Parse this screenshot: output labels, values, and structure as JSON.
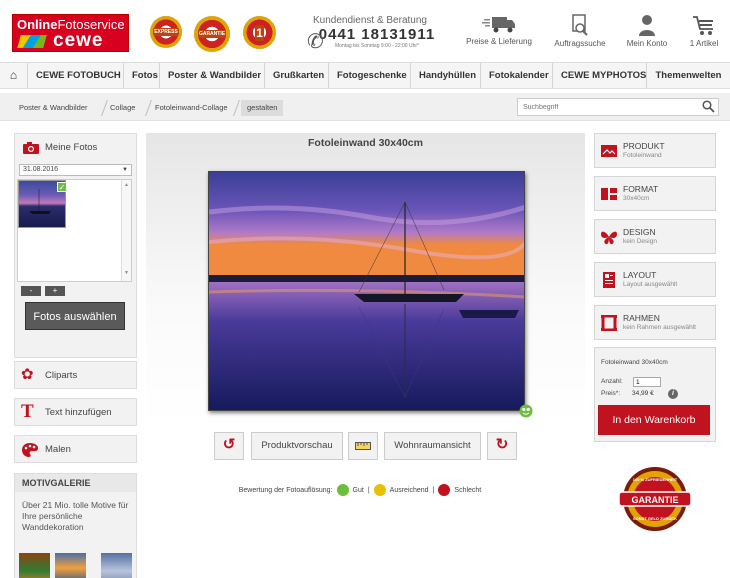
{
  "brand": {
    "line1_bold": "Online",
    "line1": "Fotoservice",
    "line2": "cewe"
  },
  "seals": [
    {
      "label": "EXPRESS"
    },
    {
      "label": "GARANTIE"
    },
    {
      "label": "1"
    }
  ],
  "hotline": {
    "label": "Kundendienst & Beratung",
    "number": "0441 18131911",
    "hours": "Montag bis Sonntag 9:00 - 22:00 Uhr*"
  },
  "header_links": [
    {
      "label": "Preise & Lieferung"
    },
    {
      "label": "Auftragssuche"
    },
    {
      "label": "Mein Konto"
    },
    {
      "label": "1 Artikel"
    }
  ],
  "nav": [
    "CEWE FOTOBUCH",
    "Fotos",
    "Poster & Wandbilder",
    "Grußkarten",
    "Fotogeschenke",
    "Handyhüllen",
    "Fotokalender",
    "CEWE MYPHOTOS",
    "Themenwelten"
  ],
  "breadcrumb": [
    "Poster & Wandbilder",
    "Collage",
    "Fotoleinwand-Collage",
    "gestalten"
  ],
  "search": {
    "placeholder": "Suchbegriff"
  },
  "left": {
    "my_photos": "Meine Fotos",
    "date": "31.08.2016",
    "minus": "-",
    "plus": "+",
    "select_photos": "Fotos auswählen",
    "cliparts": "Cliparts",
    "add_text": "Text hinzufügen",
    "paint": "Malen",
    "gallery_title": "MOTIVGALERIE",
    "gallery_text": "Über 21 Mio. tolle Motive für Ihre persönliche Wanddekoration"
  },
  "center": {
    "title": "Fotoleinwand 30x40cm",
    "preview": "Produktvorschau",
    "room_view": "Wohnraumansicht",
    "rating_label": "Bewertung der Fotoauflösung:",
    "good": "Gut",
    "sufficient": "Ausreichend",
    "bad": "Schlecht",
    "sep": "|"
  },
  "right": {
    "options": [
      {
        "title": "PRODUKT",
        "value": "Fotoleinwand",
        "icon": "image-icon"
      },
      {
        "title": "FORMAT",
        "value": "30x40cm",
        "icon": "format-icon"
      },
      {
        "title": "DESIGN",
        "value": "kein Design",
        "icon": "butterfly-icon"
      },
      {
        "title": "LAYOUT",
        "value": "Layout ausgewählt",
        "icon": "layout-icon"
      },
      {
        "title": "RAHMEN",
        "value": "kein Rahmen ausgewählt",
        "icon": "frame-icon"
      }
    ],
    "order": {
      "product": "Fotoleinwand 30x40cm",
      "qty_label": "Anzahl:",
      "qty": "1",
      "price_label": "Preis*:",
      "price": "34,99 €",
      "info": "i",
      "cart": "In den Warenkorb"
    },
    "guarantee": {
      "top": "100 % ZUFRIEDENHEIT",
      "main": "GARANTIE",
      "bottom": "SONST GELD ZURÜCK"
    }
  },
  "colors": {
    "brand_red": "#c1121f",
    "good_green": "#6cbf3b",
    "ok_yellow": "#e8c000",
    "bad_red": "#c1121f"
  }
}
